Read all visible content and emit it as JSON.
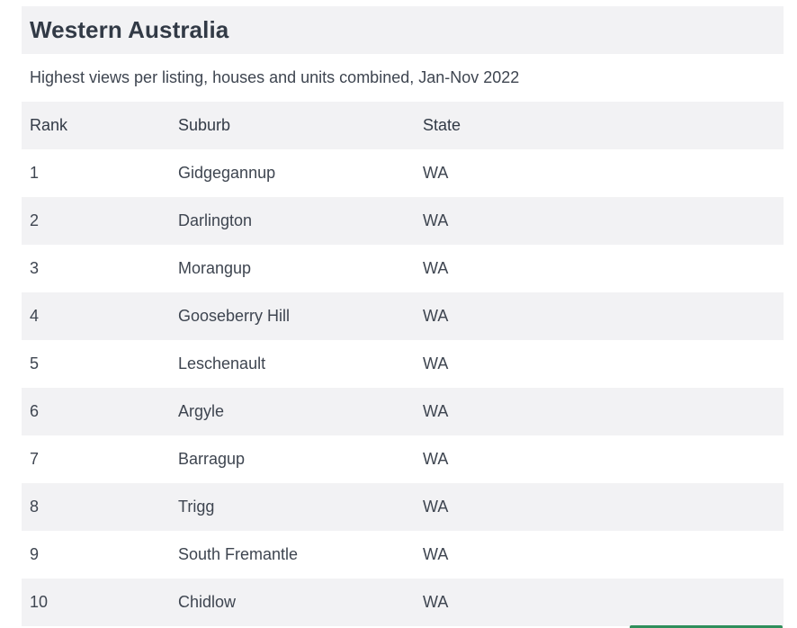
{
  "table": {
    "title": "Western Australia",
    "subtitle": "Highest views per listing, houses and units combined, Jan-Nov 2022",
    "columns": [
      "Rank",
      "Suburb",
      "State"
    ],
    "rows": [
      {
        "rank": "1",
        "suburb": "Gidgegannup",
        "state": "WA"
      },
      {
        "rank": "2",
        "suburb": "Darlington",
        "state": "WA"
      },
      {
        "rank": "3",
        "suburb": "Morangup",
        "state": "WA"
      },
      {
        "rank": "4",
        "suburb": "Gooseberry Hill",
        "state": "WA"
      },
      {
        "rank": "5",
        "suburb": "Leschenault",
        "state": "WA"
      },
      {
        "rank": "6",
        "suburb": "Argyle",
        "state": "WA"
      },
      {
        "rank": "7",
        "suburb": "Barragup",
        "state": "WA"
      },
      {
        "rank": "8",
        "suburb": "Trigg",
        "state": "WA"
      },
      {
        "rank": "9",
        "suburb": "South Fremantle",
        "state": "WA"
      },
      {
        "rank": "10",
        "suburb": "Chidlow",
        "state": "WA"
      }
    ]
  },
  "colors": {
    "row_alt": "#f2f2f4",
    "text": "#3e4550",
    "accent": "#2f8f5b"
  }
}
